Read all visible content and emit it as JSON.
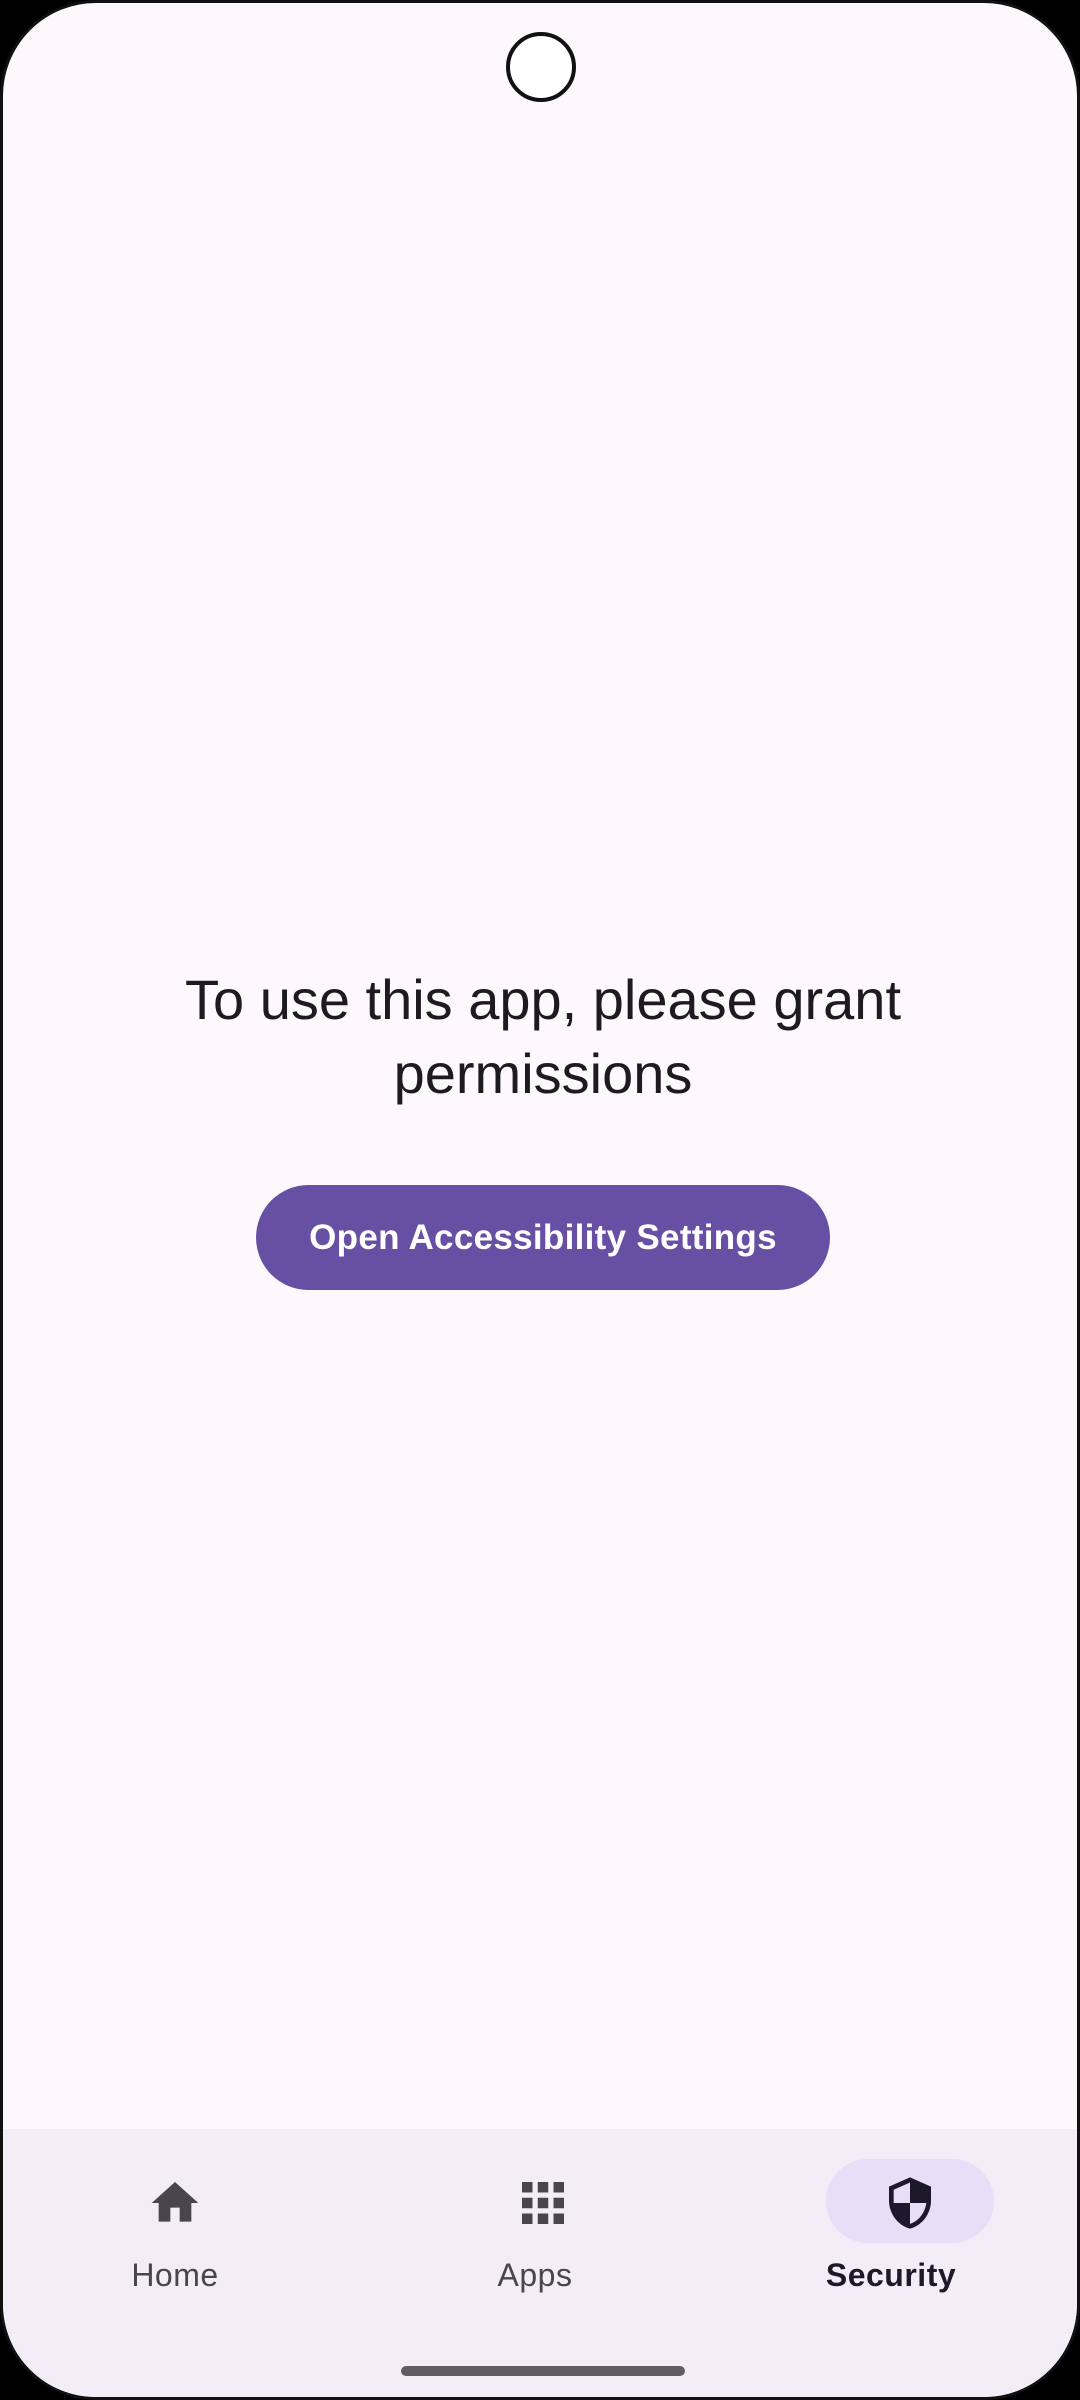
{
  "screen": {
    "message": "To use this app, please grant permissions",
    "button_label": "Open Accessibility Settings"
  },
  "bottom_nav": {
    "items": [
      {
        "label": "Home",
        "icon": "home-icon",
        "selected": false
      },
      {
        "label": "Apps",
        "icon": "apps-grid-icon",
        "selected": false
      },
      {
        "label": "Security",
        "icon": "shield-icon",
        "selected": true
      }
    ]
  },
  "colors": {
    "background": "#fdf8fc",
    "primary": "#6750a4",
    "nav_background": "#f3edf7",
    "nav_indicator": "#e8def8"
  }
}
